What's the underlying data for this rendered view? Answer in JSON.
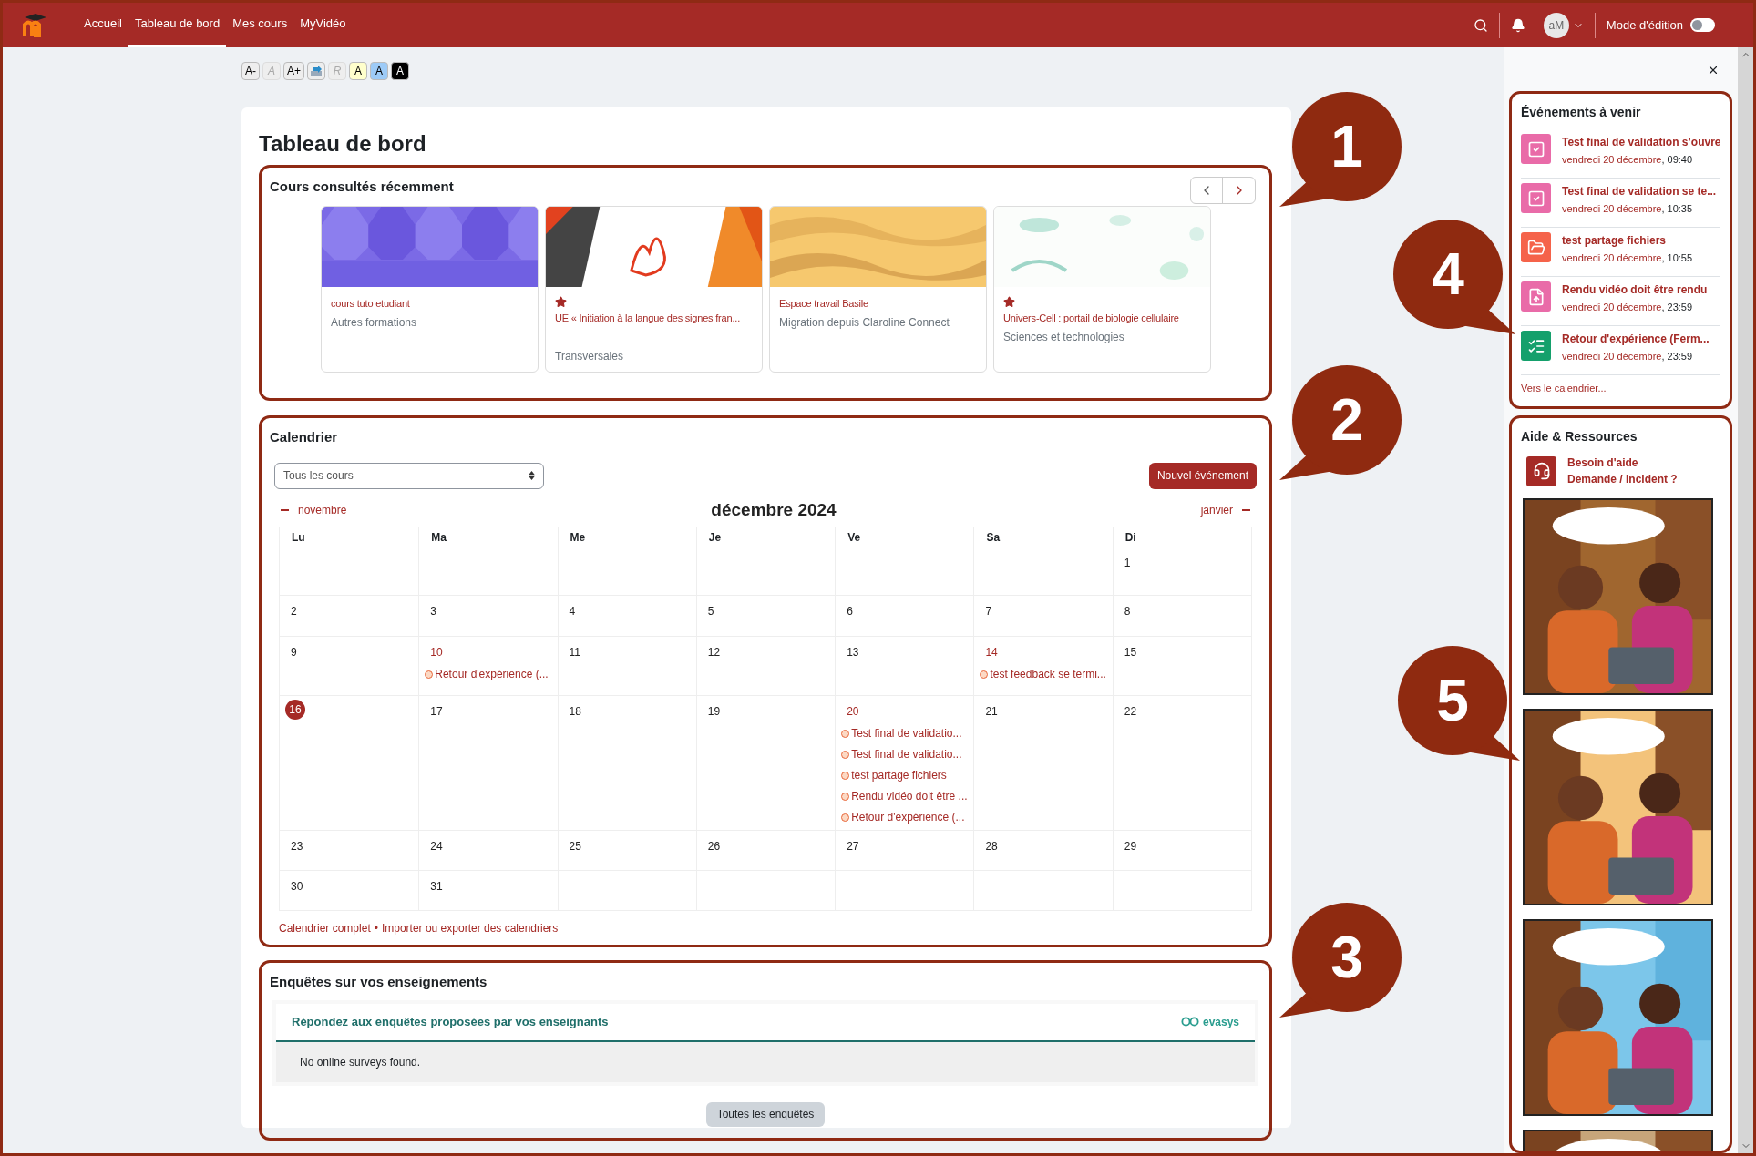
{
  "nav": {
    "links": [
      {
        "label": "Accueil",
        "selected": false
      },
      {
        "label": "Tableau de bord",
        "selected": true
      },
      {
        "label": "Mes cours",
        "selected": false
      },
      {
        "label": "MyVidéo",
        "selected": false
      }
    ],
    "user_initials": "aM",
    "edit_mode": {
      "label": "Mode d'édition",
      "on": false
    }
  },
  "font_toolbar": [
    {
      "kind": "text",
      "label": "A-",
      "disabled": false,
      "color": "#eeeeee"
    },
    {
      "kind": "text",
      "label": "A",
      "disabled": true,
      "color": "#eeeeee"
    },
    {
      "kind": "text",
      "label": "A+",
      "disabled": false,
      "color": "#eeeeee"
    },
    {
      "kind": "icon",
      "color": "#eeeeee"
    },
    {
      "kind": "text",
      "label": "R",
      "disabled": true,
      "color": "#eeeeee"
    },
    {
      "kind": "text",
      "label": "A",
      "disabled": false,
      "color": "#ffffcc"
    },
    {
      "kind": "text",
      "label": "A",
      "disabled": false,
      "color": "#9dcbf7"
    },
    {
      "kind": "text",
      "label": "A",
      "disabled": false,
      "color": "#000000"
    }
  ],
  "page_title": "Tableau de bord",
  "recent_courses": {
    "title": "Cours consultés récemment",
    "cards": [
      {
        "name": "cours tuto etudiant",
        "category": "Autres formations",
        "starred": false
      },
      {
        "name": "UE « Initiation à la langue des signes fran...",
        "category": "Transversales",
        "starred": true
      },
      {
        "name": "Espace travail Basile",
        "category": "Migration depuis Claroline Connect",
        "starred": false
      },
      {
        "name": "Univers-Cell : portail de biologie cellulaire",
        "category": "Sciences et technologies",
        "starred": true
      }
    ]
  },
  "calendar": {
    "title": "Calendrier",
    "course_filter": "Tous les cours",
    "new_event_button": "Nouvel événement",
    "prev_month": "novembre",
    "month": "décembre 2024",
    "next_month": "janvier",
    "weekdays": [
      "Lu",
      "Ma",
      "Me",
      "Je",
      "Ve",
      "Sa",
      "Di"
    ],
    "weeks": [
      [
        {
          "kind": "blank"
        },
        {
          "kind": "blank"
        },
        {
          "kind": "blank"
        },
        {
          "kind": "blank"
        },
        {
          "kind": "blank"
        },
        {
          "kind": "blank"
        },
        {
          "kind": "day",
          "day": "1",
          "today": false
        }
      ],
      [
        {
          "kind": "day",
          "day": "2",
          "today": false
        },
        {
          "kind": "day",
          "day": "3",
          "today": false
        },
        {
          "kind": "day",
          "day": "4",
          "today": false
        },
        {
          "kind": "day",
          "day": "5",
          "today": false
        },
        {
          "kind": "day",
          "day": "6",
          "today": false
        },
        {
          "kind": "day",
          "day": "7",
          "today": false
        },
        {
          "kind": "day",
          "day": "8",
          "today": false
        }
      ],
      [
        {
          "kind": "day",
          "day": "9",
          "today": false
        },
        {
          "kind": "day",
          "day": "10",
          "today": false,
          "events": [
            "Retour d'expérience (..."
          ]
        },
        {
          "kind": "day",
          "day": "11",
          "today": false
        },
        {
          "kind": "day",
          "day": "12",
          "today": false
        },
        {
          "kind": "day",
          "day": "13",
          "today": false
        },
        {
          "kind": "day",
          "day": "14",
          "today": false,
          "events": [
            "test feedback se termi..."
          ]
        },
        {
          "kind": "day",
          "day": "15",
          "today": false
        }
      ],
      [
        {
          "kind": "day",
          "day": "16",
          "today": true
        },
        {
          "kind": "day",
          "day": "17",
          "today": false
        },
        {
          "kind": "day",
          "day": "18",
          "today": false
        },
        {
          "kind": "day",
          "day": "19",
          "today": false
        },
        {
          "kind": "day",
          "day": "20",
          "today": false,
          "events": [
            "Test final de validatio...",
            "Test final de validatio...",
            "test partage fichiers",
            "Rendu vidéo doit être ...",
            "Retour d'expérience (..."
          ]
        },
        {
          "kind": "day",
          "day": "21",
          "today": false
        },
        {
          "kind": "day",
          "day": "22",
          "today": false
        }
      ],
      [
        {
          "kind": "day",
          "day": "23",
          "today": false
        },
        {
          "kind": "day",
          "day": "24",
          "today": false
        },
        {
          "kind": "day",
          "day": "25",
          "today": false
        },
        {
          "kind": "day",
          "day": "26",
          "today": false
        },
        {
          "kind": "day",
          "day": "27",
          "today": false
        },
        {
          "kind": "day",
          "day": "28",
          "today": false
        },
        {
          "kind": "day",
          "day": "29",
          "today": false
        }
      ],
      [
        {
          "kind": "day",
          "day": "30",
          "today": false
        },
        {
          "kind": "day",
          "day": "31",
          "today": false
        },
        {
          "kind": "blank"
        },
        {
          "kind": "blank"
        },
        {
          "kind": "blank"
        },
        {
          "kind": "blank"
        },
        {
          "kind": "blank"
        }
      ]
    ],
    "footer_links": [
      "Calendrier complet",
      "•",
      "Importer ou exporter des calendriers"
    ]
  },
  "surveys": {
    "title": "Enquêtes sur vos enseignements",
    "subtitle": "Répondez aux enquêtes proposées par vos enseignants",
    "logo": "evasys",
    "message": "No online surveys found.",
    "button": "Toutes les enquêtes"
  },
  "upcoming_events": {
    "title": "Événements à venir",
    "items": [
      {
        "kind": "quiz",
        "color": "#e96ba8",
        "title": "Test final de validation s’ouvre",
        "date": "vendredi 20 décembre",
        "time": ", 09:40"
      },
      {
        "kind": "quiz",
        "color": "#e96ba8",
        "title": "Test final de validation se te...",
        "date": "vendredi 20 décembre",
        "time": ", 10:35"
      },
      {
        "kind": "folder",
        "color": "#f5634a",
        "title": "test partage fichiers",
        "date": "vendredi 20 décembre",
        "time": ", 10:55"
      },
      {
        "kind": "upload",
        "color": "#e96ba8",
        "title": "Rendu vidéo doit être rendu",
        "date": "vendredi 20 décembre",
        "time": ", 23:59"
      },
      {
        "kind": "feedback",
        "color": "#15a06c",
        "title": "Retour d'expérience (Ferm...",
        "date": "vendredi 20 décembre",
        "time": ", 23:59"
      }
    ],
    "link": "Vers le calendrier..."
  },
  "help": {
    "title": "Aide & Ressources",
    "link_lines": [
      "Besoin d'aide",
      "Demande / Incident ?"
    ],
    "comics": [
      {
        "kind": "picture"
      },
      {
        "kind": "picture"
      },
      {
        "kind": "picture"
      },
      {
        "kind": "picture"
      }
    ]
  },
  "callouts": [
    "1",
    "2",
    "3",
    "4",
    "5"
  ]
}
